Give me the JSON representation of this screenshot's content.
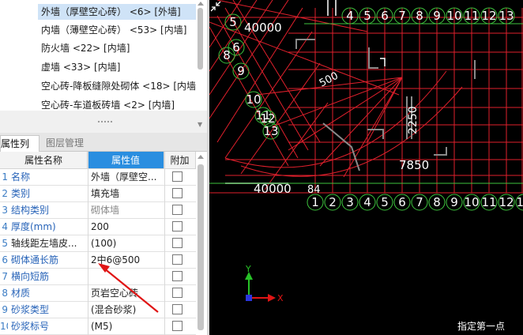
{
  "wall_list": {
    "items": [
      {
        "label": "外墙（厚壁空心砖） <6> [外墙]",
        "selected": true
      },
      {
        "label": "内墙（薄壁空心砖） <53> [内墙]",
        "selected": false
      },
      {
        "label": "防火墙 <22> [内墙]",
        "selected": false
      },
      {
        "label": "虚墙 <33> [内墙]",
        "selected": false
      },
      {
        "label": "空心砖-降板缝隙处砌体 <18> [内墙]",
        "selected": false
      },
      {
        "label": "空心砖-车道板砖墙 <2> [内墙]",
        "selected": false
      }
    ]
  },
  "tabs": {
    "properties": "属性列表",
    "layers": "图层管理"
  },
  "table": {
    "headers": {
      "name": "属性名称",
      "value": "属性值",
      "extra": "附加"
    },
    "rows": [
      {
        "idx": "1",
        "name": "名称",
        "value": "外墙（厚壁空..."
      },
      {
        "idx": "2",
        "name": "类别",
        "value": "填充墙"
      },
      {
        "idx": "3",
        "name": "结构类别",
        "value": "砌体墙"
      },
      {
        "idx": "4",
        "name": "厚度(mm)",
        "value": "200"
      },
      {
        "idx": "5",
        "name": "轴线距左墙皮...",
        "value": "(100)"
      },
      {
        "idx": "6",
        "name": "砌体通长筋",
        "value": "2中6@500"
      },
      {
        "idx": "7",
        "name": "横向短筋",
        "value": ""
      },
      {
        "idx": "8",
        "name": "材质",
        "value": "页岩空心砖"
      },
      {
        "idx": "9",
        "name": "砂浆类型",
        "value": "(混合砂浆)"
      },
      {
        "idx": "10",
        "name": "砂浆标号",
        "value": "(M5)"
      }
    ]
  },
  "canvas": {
    "top_labels": [
      "4",
      "5",
      "6",
      "7",
      "8",
      "9",
      "10",
      "11",
      "12",
      "13"
    ],
    "bottom_labels": [
      "1",
      "2",
      "3",
      "4",
      "5",
      "6",
      "7",
      "8",
      "9",
      "10",
      "11",
      "12",
      "13"
    ],
    "left_labels": [
      "5",
      "6",
      "8",
      "9",
      "10",
      "11",
      "12",
      "13"
    ],
    "dim_top": "40000",
    "dim_bottom": "40000",
    "dim_bottom_prefix": "84",
    "dim_mid": "7850",
    "dim_diag": "500",
    "dim_vertical": "2250",
    "axis_x": "X",
    "axis_y": "Y",
    "status": "指定第一点",
    "colors": {
      "grid": "#e0202c",
      "bubble": "#3ec43e",
      "text": "#ffffff",
      "wall": "#8a8a8a"
    }
  }
}
